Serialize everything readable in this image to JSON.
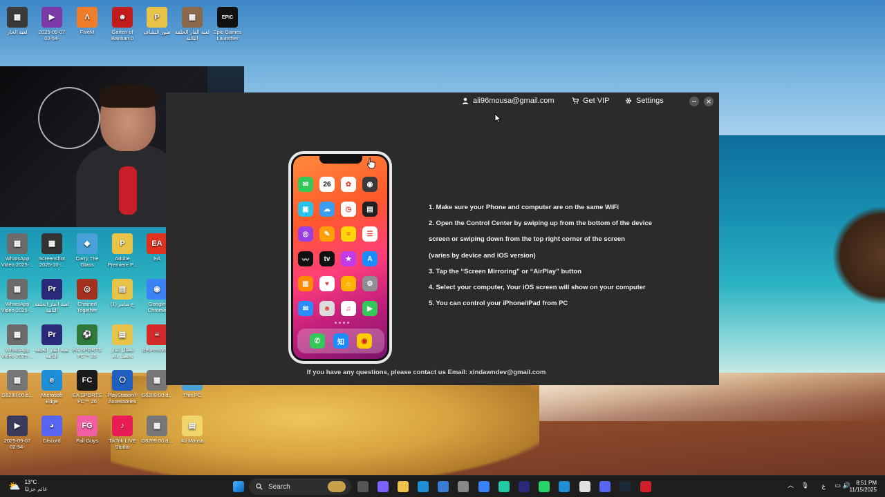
{
  "desktop": {
    "icons": [
      {
        "label": "لعبة الحار",
        "color": "#3a3a3a",
        "glyph": "▦"
      },
      {
        "label": "2025-09-07 02-54-23.000...",
        "color": "#7b3aa8",
        "glyph": "▶"
      },
      {
        "label": "FiveM",
        "color": "#f07d2a",
        "glyph": "Λ"
      },
      {
        "label": "Garten of Banban 0",
        "color": "#c21d1d",
        "glyph": "☻"
      },
      {
        "label": "صور التشاف",
        "color": "#e8c34a",
        "glyph": "P"
      },
      {
        "label": "لعبة الفار الحلقة الثالثة",
        "color": "#8a6a4a",
        "glyph": "▦"
      },
      {
        "label": "Epic Games Launcher",
        "color": "#111111",
        "glyph": "EPIC"
      },
      {
        "label": "WhatsApp Video 2025-...",
        "color": "#6b6b6b",
        "glyph": "▦"
      },
      {
        "label": "Screenshot 2025-10-...",
        "color": "#333333",
        "glyph": "▦"
      },
      {
        "label": "Carry The Glass",
        "color": "#4aa0d8",
        "glyph": "◆"
      },
      {
        "label": "Adobe Premiere P...",
        "color": "#e8c34a",
        "glyph": "P"
      },
      {
        "label": "EA",
        "color": "#e0301e",
        "glyph": "EA"
      },
      {
        "label": "WhatsApp Video 2025-...",
        "color": "#6b6b6b",
        "glyph": "▦"
      },
      {
        "label": "لعبة الفار الحلقة الثانية",
        "color": "#2a2a7a",
        "glyph": "Pr"
      },
      {
        "label": "Chained Together",
        "color": "#a6301e",
        "glyph": "◎"
      },
      {
        "label": "ع سامر (1)",
        "color": "#e8c34a",
        "glyph": "▤"
      },
      {
        "label": "Google Chrome",
        "color": "#3b82f6",
        "glyph": "◉"
      },
      {
        "label": "WhatsApp Video 2025-...",
        "color": "#6b6b6b",
        "glyph": "▦"
      },
      {
        "label": "لعبة الفار الحلقة الثانية",
        "color": "#2a2a7a",
        "glyph": "Pr"
      },
      {
        "label": "EA SPORTS FC™ 25",
        "color": "#2f7a3a",
        "glyph": "⚽"
      },
      {
        "label": "ابطال الدار تحميل دام",
        "color": "#e8c34a",
        "glyph": "▤"
      },
      {
        "label": "ExpressVPN",
        "color": "#d42a2a",
        "glyph": "≡"
      },
      {
        "label": "G6289.00.d...",
        "color": "#777777",
        "glyph": "▦"
      },
      {
        "label": "Microsoft Edge",
        "color": "#1e8fd6",
        "glyph": "e"
      },
      {
        "label": "EA SPORTS FC™ 26",
        "color": "#1a1a1a",
        "glyph": "FC"
      },
      {
        "label": "PlayStation® Accessories",
        "color": "#1f5fbf",
        "glyph": "⎔"
      },
      {
        "label": "G6289.00.d...",
        "color": "#777777",
        "glyph": "▦"
      },
      {
        "label": "This PC",
        "color": "#4aa0d8",
        "glyph": "▭"
      },
      {
        "label": "2025-09-07 02-54-23.000...",
        "color": "#3a3a5a",
        "glyph": "▶"
      },
      {
        "label": "Discord",
        "color": "#5865f2",
        "glyph": "◕"
      },
      {
        "label": "Fall Guys",
        "color": "#f25fa5",
        "glyph": "FG"
      },
      {
        "label": "TikTok LIVE Studio",
        "color": "#e81d55",
        "glyph": "♪"
      },
      {
        "label": "G6289.00.d...",
        "color": "#777777",
        "glyph": "▦"
      },
      {
        "label": "Ali Mousa",
        "color": "#f0d56a",
        "glyph": "▤"
      }
    ]
  },
  "app": {
    "account_email": "ali96mousa@gmail.com",
    "get_vip_label": "Get VIP",
    "settings_label": "Settings",
    "instructions": [
      "1. Make sure your Phone and computer are on the same WiFi",
      "2. Open the Control Center by swiping up from the bottom of the device",
      "screen or swiping down from the top right corner of the screen",
      "(varies by device and iOS version)",
      "3. Tap the “Screen Mirroring” or “AirPlay” button",
      "4. Select your computer, Your iOS screen will show on your computer",
      "5. You can control your iPhone/iPad from PC"
    ],
    "contact": "If you have any questions, please contact us Email: xindawndev@gmail.com",
    "phone": {
      "calendar_day": "26",
      "apps": [
        {
          "icon": "messages-icon",
          "color": "#34c759",
          "glyph": "✉"
        },
        {
          "icon": "calendar-icon",
          "color": "#ffffff",
          "glyph": "26"
        },
        {
          "icon": "photos-icon",
          "color": "#ffffff",
          "glyph": "✿"
        },
        {
          "icon": "camera-icon",
          "color": "#3a3a3c",
          "glyph": "◉"
        },
        {
          "icon": "facetime-icon",
          "color": "#27c3e8",
          "glyph": "▣"
        },
        {
          "icon": "weather-icon",
          "color": "#3b9cf0",
          "glyph": "☁"
        },
        {
          "icon": "clock-icon",
          "color": "#ffffff",
          "glyph": "◷"
        },
        {
          "icon": "wallet-icon",
          "color": "#222222",
          "glyph": "▤"
        },
        {
          "icon": "podcasts-icon",
          "color": "#9b3fe0",
          "glyph": "◎"
        },
        {
          "icon": "pages-icon",
          "color": "#ff9f0a",
          "glyph": "✎"
        },
        {
          "icon": "notes-icon",
          "color": "#ffd60a",
          "glyph": "≡"
        },
        {
          "icon": "reminders-icon",
          "color": "#ffffff",
          "glyph": "☰"
        },
        {
          "icon": "stocks-icon",
          "color": "#111111",
          "glyph": "〰"
        },
        {
          "icon": "appletv-icon",
          "color": "#111111",
          "glyph": "tv"
        },
        {
          "icon": "itunes-icon",
          "color": "#c23be8",
          "glyph": "★"
        },
        {
          "icon": "appstore-icon",
          "color": "#1a8cff",
          "glyph": "A"
        },
        {
          "icon": "books-icon",
          "color": "#ff8a00",
          "glyph": "▥"
        },
        {
          "icon": "health-icon",
          "color": "#ffffff",
          "glyph": "♥"
        },
        {
          "icon": "home-icon",
          "color": "#ffb300",
          "glyph": "⌂"
        },
        {
          "icon": "settings-icon",
          "color": "#8e8e93",
          "glyph": "⚙"
        },
        {
          "icon": "mail-icon",
          "color": "#2a8cff",
          "glyph": "✉"
        },
        {
          "icon": "contacts-icon",
          "color": "#dddddd",
          "glyph": "☻"
        },
        {
          "icon": "music-icon",
          "color": "#ffffff",
          "glyph": "♫"
        },
        {
          "icon": "facetime-green-icon",
          "color": "#34c759",
          "glyph": "▶"
        }
      ],
      "dock": [
        {
          "icon": "phone-icon",
          "color": "#34c759",
          "glyph": "✆"
        },
        {
          "icon": "zhihu-icon",
          "color": "#1a8cff",
          "glyph": "知"
        },
        {
          "icon": "weibo-icon",
          "color": "#ffcc00",
          "glyph": "◉"
        }
      ]
    }
  },
  "taskbar": {
    "weather_temp": "13°C",
    "weather_desc": "غائم جزئيًا",
    "search_label": "Search",
    "language": "ع",
    "time": "8:51 PM",
    "date": "11/15/2025"
  }
}
